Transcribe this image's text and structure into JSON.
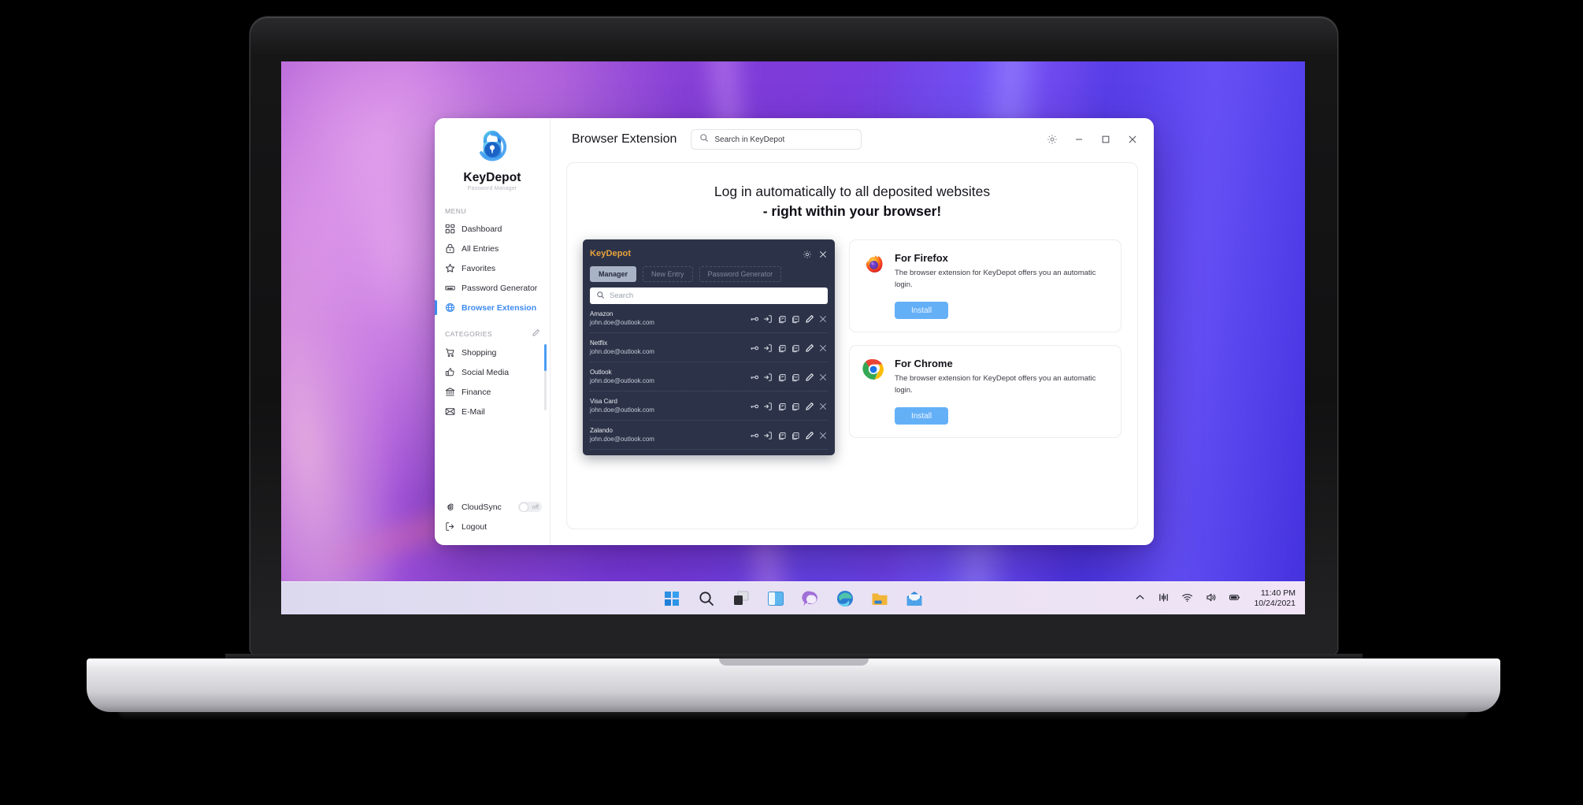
{
  "app": {
    "brand": {
      "name": "KeyDepot",
      "subtitle": "Password Manager",
      "logo_icon": "padlock-logo-icon"
    },
    "page_title": "Browser Extension",
    "search": {
      "placeholder": "Search in KeyDepot",
      "value": "",
      "icon": "search-icon"
    },
    "window_controls": [
      {
        "name": "settings",
        "label": "gear-icon"
      },
      {
        "name": "minimize",
        "label": "minimize-icon"
      },
      {
        "name": "maximize",
        "label": "maximize-icon"
      },
      {
        "name": "close",
        "label": "close-icon"
      }
    ],
    "sidebar": {
      "menu_label": "MENU",
      "menu_items": [
        {
          "label": "Dashboard",
          "icon": "dashboard-icon",
          "active": false
        },
        {
          "label": "All Entries",
          "icon": "lock-icon",
          "active": false
        },
        {
          "label": "Favorites",
          "icon": "star-icon",
          "active": false
        },
        {
          "label": "Password Generator",
          "icon": "keyboard-icon",
          "active": false
        },
        {
          "label": "Browser Extension",
          "icon": "globe-icon",
          "active": true
        }
      ],
      "categories_label": "CATEGORIES",
      "categories_edit_icon": "pencil-icon",
      "categories": [
        {
          "label": "Shopping",
          "icon": "cart-icon"
        },
        {
          "label": "Social Media",
          "icon": "thumbs-up-icon"
        },
        {
          "label": "Finance",
          "icon": "bank-icon"
        },
        {
          "label": "E-Mail",
          "icon": "envelope-icon"
        }
      ],
      "cloudsync": {
        "label": "CloudSync",
        "icon": "cloud-sync-icon",
        "state": "off"
      },
      "logout": {
        "label": "Logout",
        "icon": "logout-icon"
      }
    },
    "headline": {
      "line1": "Log in automatically to all deposited websites",
      "line2": "- right within your browser!"
    },
    "extension_popup": {
      "title": "KeyDepot",
      "header_icons": [
        "gear-icon",
        "close-icon"
      ],
      "tabs": [
        {
          "label": "Manager",
          "active": true
        },
        {
          "label": "New Entry",
          "active": false
        },
        {
          "label": "Password Generator",
          "active": false
        }
      ],
      "search_placeholder": "Search",
      "row_action_icons": [
        "key-icon",
        "autofill-login-icon",
        "copy-password-icon",
        "copy-username-icon",
        "edit-pencil-icon",
        "delete-close-icon"
      ],
      "entries": [
        {
          "site": "Amazon",
          "username": "john.doe@outlook.com"
        },
        {
          "site": "Netflix",
          "username": "john.doe@outlook.com"
        },
        {
          "site": "Outlook",
          "username": "john.doe@outlook.com"
        },
        {
          "site": "Visa Card",
          "username": "john.doe@outlook.com"
        },
        {
          "site": "Zalando",
          "username": "john.doe@outlook.com"
        }
      ]
    },
    "browser_cards": [
      {
        "title": "For Firefox",
        "logo": "firefox-logo-icon",
        "text": "The browser extension for KeyDepot offers you an automatic login.",
        "button": "Install"
      },
      {
        "title": "For Chrome",
        "logo": "chrome-logo-icon",
        "text": "The browser extension for KeyDepot offers you an automatic login.",
        "button": "Install"
      }
    ]
  },
  "taskbar": {
    "items": [
      {
        "name": "start",
        "icon": "windows-start-icon"
      },
      {
        "name": "search",
        "icon": "search-icon"
      },
      {
        "name": "task-view",
        "icon": "task-view-icon"
      },
      {
        "name": "widgets",
        "icon": "widgets-icon"
      },
      {
        "name": "chat",
        "icon": "chat-icon"
      },
      {
        "name": "edge",
        "icon": "edge-icon"
      },
      {
        "name": "file-explorer",
        "icon": "folder-icon"
      },
      {
        "name": "mail",
        "icon": "mail-icon"
      }
    ],
    "tray": [
      {
        "name": "show-hidden-icons",
        "icon": "chevron-up-icon"
      },
      {
        "name": "equalizer",
        "icon": "equalizer-icon"
      },
      {
        "name": "wifi",
        "icon": "wifi-icon"
      },
      {
        "name": "volume",
        "icon": "speaker-icon"
      },
      {
        "name": "battery",
        "icon": "battery-icon"
      }
    ],
    "clock": {
      "time": "11:40 PM",
      "date": "10/24/2021"
    }
  },
  "colors": {
    "accent_blue": "#3c8bf0",
    "install_button": "#64b0f7",
    "popup_bg": "#2c3348",
    "popup_title_orange": "#e8a33d",
    "taskbar_bg": "#e7e1f3"
  }
}
